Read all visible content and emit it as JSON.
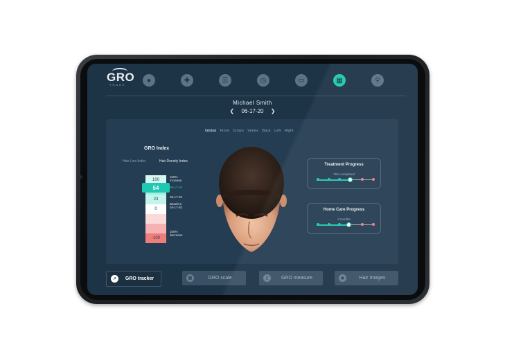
{
  "app": {
    "logo_text": "GRO",
    "logo_sub": "TRACK"
  },
  "nav": {
    "icons": [
      "user-icon",
      "medical-plus-icon",
      "document-icon",
      "clock-icon",
      "card-icon",
      "gallery-icon",
      "search-icon"
    ],
    "active_index": 5
  },
  "patient": {
    "name": "Michael Smith",
    "date": "06-17-20"
  },
  "views": [
    "Global",
    "Front",
    "Crown",
    "Vertex",
    "Back",
    "Left",
    "Right"
  ],
  "index": {
    "title": "GRO Index",
    "tabs": [
      "Hair Line Index",
      "Hair Density Index"
    ],
    "scale_cells": [
      "100",
      "",
      "23",
      "0",
      "",
      "",
      "-100"
    ],
    "current_value": "54",
    "labels": {
      "top": "100%\nIncrease",
      "current_date": "06-17-20",
      "mid_date": "06-17-20",
      "baseline": "Baseline\n04-17-20",
      "bottom": "100%\ndecrease"
    }
  },
  "treatment": {
    "title": "Treatment Progress",
    "subtitle": "76% completed",
    "progress": 0.6
  },
  "homecare": {
    "title": "Home Care Progress",
    "subtitle": "3 months",
    "progress": 0.58
  },
  "bottom_tabs": [
    {
      "label": "GRO tracker",
      "icon": "trend-icon"
    },
    {
      "label": "GRO scale",
      "icon": "bar-chart-icon"
    },
    {
      "label": "GRO measure",
      "icon": "ruler-icon"
    },
    {
      "label": "Hair Images",
      "icon": "camera-icon"
    }
  ],
  "colors": {
    "accent": "#1fc8b0",
    "screen_bg": "#1d3346",
    "panel_bg": "#253d52",
    "decrease": "#f07c7c"
  }
}
